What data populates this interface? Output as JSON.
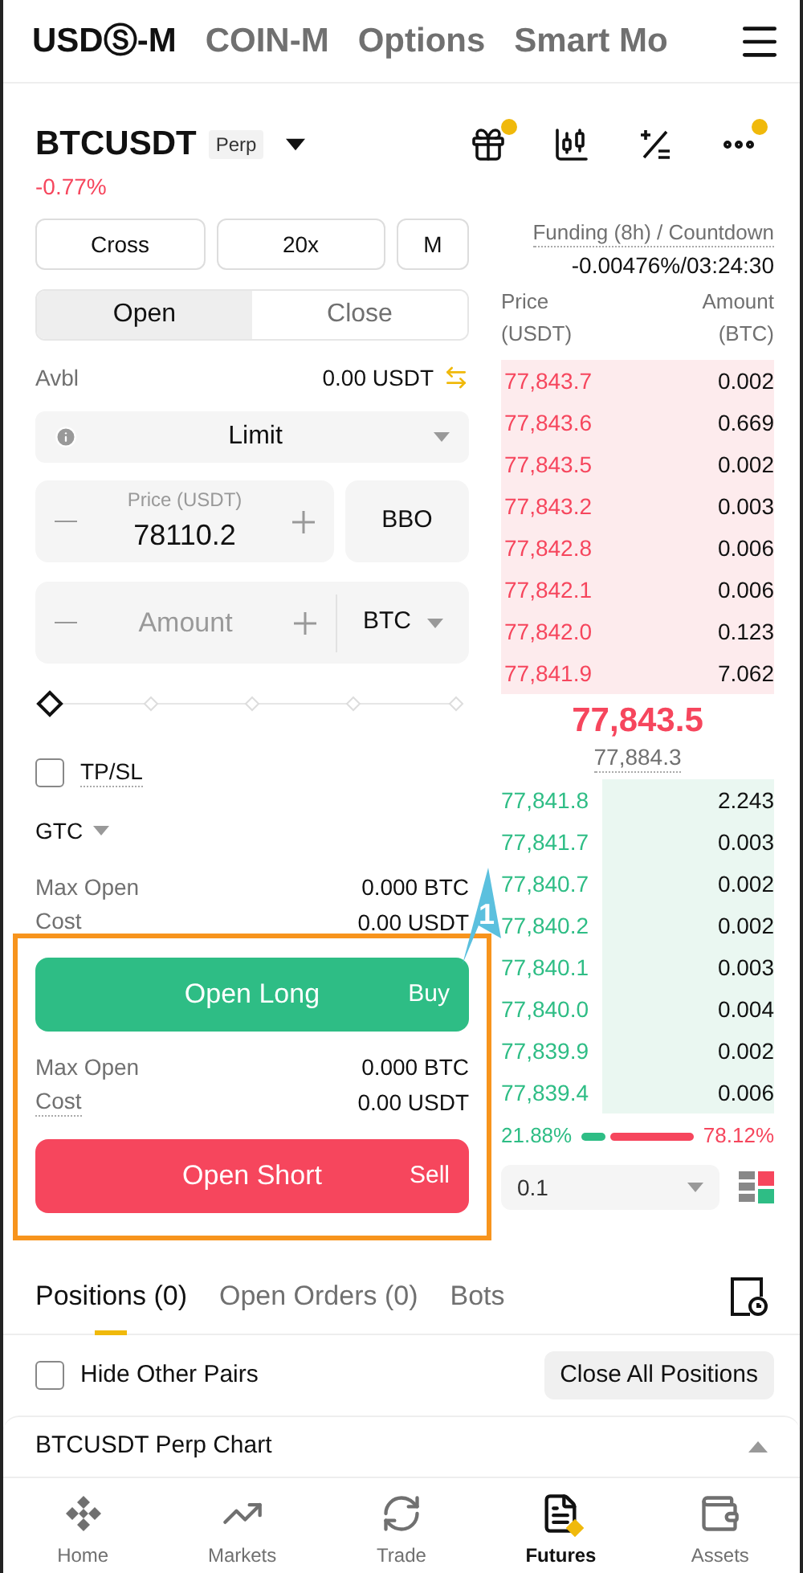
{
  "top_tabs": [
    {
      "label": "USDⓈ-M",
      "selected": true
    },
    {
      "label": "COIN-M",
      "selected": false
    },
    {
      "label": "Options",
      "selected": false
    },
    {
      "label": "Smart Mo",
      "selected": false
    }
  ],
  "symbol": {
    "name": "BTCUSDT",
    "badge": "Perp",
    "change": "-0.77%"
  },
  "header_icons": [
    {
      "kind": "gift",
      "dot": true
    },
    {
      "kind": "candles",
      "dot": false
    },
    {
      "kind": "calculator",
      "dot": false
    },
    {
      "kind": "more",
      "dot": true
    }
  ],
  "margin_buttons": [
    "Cross",
    "20x",
    "M"
  ],
  "side_tabs": [
    {
      "label": "Open",
      "selected": true
    },
    {
      "label": "Close",
      "selected": false
    }
  ],
  "available": {
    "label": "Avbl",
    "value": "0.00 USDT"
  },
  "order_type": "Limit",
  "price_field": {
    "label": "Price (USDT)",
    "value": "78110.2"
  },
  "bbo": "BBO",
  "amount_field": {
    "placeholder": "Amount",
    "unit": "BTC"
  },
  "tpsl": {
    "label": "TP/SL",
    "checked": false
  },
  "time_in_force": "GTC",
  "long_info": [
    {
      "label": "Max Open",
      "value": "0.000 BTC"
    },
    {
      "label": "Cost",
      "value": "0.00 USDT"
    }
  ],
  "long_button": {
    "label": "Open Long",
    "side": "Buy"
  },
  "short_info": [
    {
      "label": "Max Open",
      "value": "0.000 BTC"
    },
    {
      "label": "Cost",
      "value": "0.00 USDT"
    }
  ],
  "short_button": {
    "label": "Open Short",
    "side": "Sell"
  },
  "callout": {
    "label": "1"
  },
  "funding": {
    "label": "Funding (8h) / Countdown",
    "value": "-0.00476%/03:24:30"
  },
  "book_columns": [
    {
      "title": "Price",
      "unit": "(USDT)"
    },
    {
      "title": "Amount",
      "unit": "(BTC)"
    }
  ],
  "asks": [
    {
      "price": "77,843.7",
      "amount": "0.002"
    },
    {
      "price": "77,843.6",
      "amount": "0.669"
    },
    {
      "price": "77,843.5",
      "amount": "0.002"
    },
    {
      "price": "77,843.2",
      "amount": "0.003"
    },
    {
      "price": "77,842.8",
      "amount": "0.006"
    },
    {
      "price": "77,842.1",
      "amount": "0.006"
    },
    {
      "price": "77,842.0",
      "amount": "0.123"
    },
    {
      "price": "77,841.9",
      "amount": "7.062"
    }
  ],
  "last_price": "77,843.5",
  "mark_price": "77,884.3",
  "bids": [
    {
      "price": "77,841.8",
      "amount": "2.243"
    },
    {
      "price": "77,841.7",
      "amount": "0.003"
    },
    {
      "price": "77,840.7",
      "amount": "0.002"
    },
    {
      "price": "77,840.2",
      "amount": "0.002"
    },
    {
      "price": "77,840.1",
      "amount": "0.003"
    },
    {
      "price": "77,840.0",
      "amount": "0.004"
    },
    {
      "price": "77,839.9",
      "amount": "0.002"
    },
    {
      "price": "77,839.4",
      "amount": "0.006"
    }
  ],
  "ratio": {
    "buy": "21.88%",
    "sell": "78.12%",
    "level": 0.2188
  },
  "precision": "0.1",
  "bottom_tabs": [
    {
      "label": "Positions (0)",
      "selected": true
    },
    {
      "label": "Open Orders (0)",
      "selected": false
    },
    {
      "label": "Bots",
      "selected": false
    }
  ],
  "hide_other_pairs": {
    "label": "Hide Other Pairs",
    "checked": false
  },
  "close_all": "Close All Positions",
  "chart_row": "BTCUSDT Perp Chart",
  "nav": [
    {
      "label": "Home",
      "kind": "home",
      "selected": false
    },
    {
      "label": "Markets",
      "kind": "markets",
      "selected": false
    },
    {
      "label": "Trade",
      "kind": "trade",
      "selected": false
    },
    {
      "label": "Futures",
      "kind": "futures",
      "selected": true
    },
    {
      "label": "Assets",
      "kind": "assets",
      "selected": false
    }
  ]
}
